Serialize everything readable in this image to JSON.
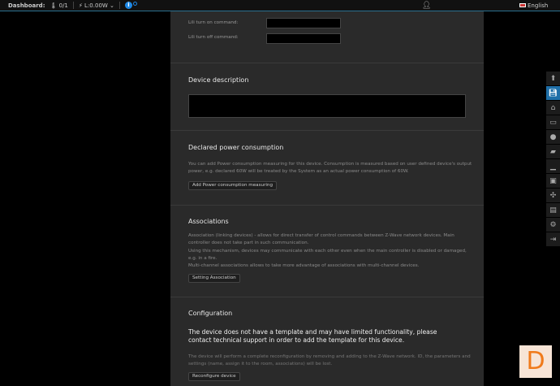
{
  "topbar": {
    "dashboard": "Dashboard:",
    "sensors": "0/1",
    "power": "L:0.00W",
    "language": "English"
  },
  "lili": {
    "on_label": "Lili turn on command:",
    "off_label": "Lili turn off command:"
  },
  "description": {
    "title": "Device description"
  },
  "power": {
    "title": "Declared power consumption",
    "text": "You can add Power consumption measuring for this device. Consumption is measured based on user defined device's output power, e.g. declared 60W will be treated by the System as an actual power consumption of 60W.",
    "button": "Add Power consumption measuring"
  },
  "associations": {
    "title": "Associations",
    "text1": "Association (linking devices) - allows for direct transfer of control commands between Z-Wave network devices. Main controller does not take part in such communication.",
    "text2": "Using this mechanism, devices may communicate with each other even when the main controller is disabled or damaged, e.g. in a fire.",
    "text3": "Multi-channel associations allows to take more advantage of associations with multi-channel devices.",
    "button": "Setting Association"
  },
  "configuration": {
    "title": "Configuration",
    "warning": "The device does not have a template and may have limited functionality, please contact technical support in order to add the template for this device.",
    "text": "The device will perform a complete reconfiguration by removing and adding to the Z-Wave network. ID, the parameters and settings (name, assign it to the room, associations) will be lost.",
    "button": "Reconfigure device"
  },
  "logo": "D"
}
